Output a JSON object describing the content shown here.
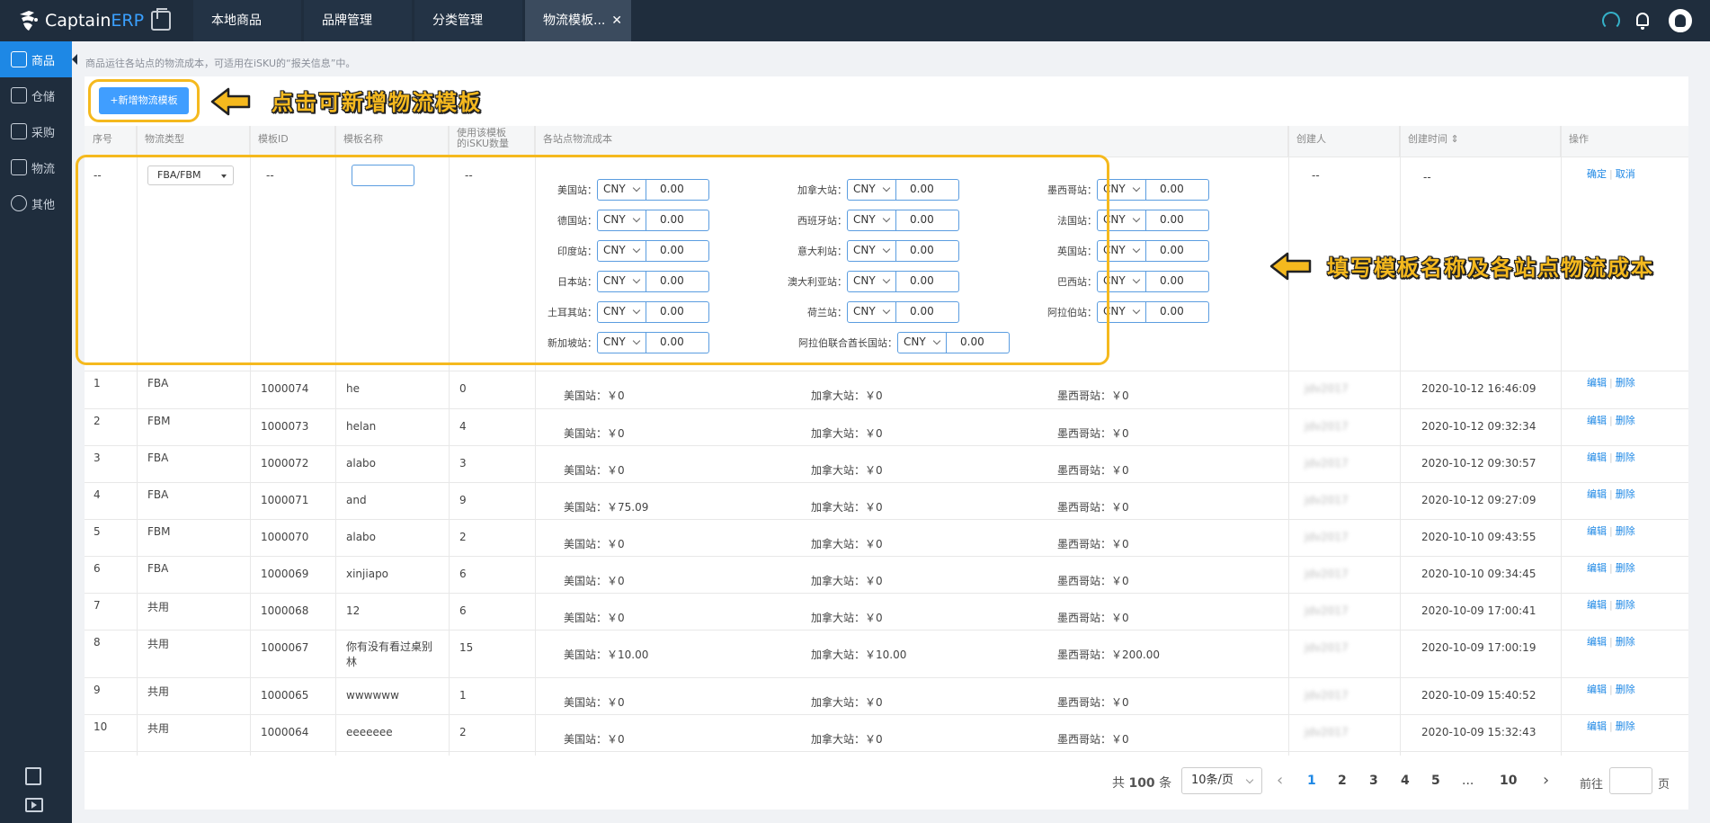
{
  "app": {
    "brand_main": "Captain",
    "brand_accent": "ERP"
  },
  "tabs": [
    {
      "label": "本地商品"
    },
    {
      "label": "品牌管理"
    },
    {
      "label": "分类管理"
    },
    {
      "label": "物流模板..."
    }
  ],
  "tab_close": "✕",
  "sidebar": [
    {
      "label": "商品"
    },
    {
      "label": "仓储"
    },
    {
      "label": "采购"
    },
    {
      "label": "物流"
    },
    {
      "label": "其他"
    }
  ],
  "hint": "商品运往各站点的物流成本，可适用在iSKU的“报关信息”中。",
  "add_button": "+新增物流模板",
  "callout_add": "点击可新增物流模板",
  "callout_fill": "填写模板名称及各站点物流成本",
  "columns": {
    "index": "序号",
    "type": "物流类型",
    "id": "模板ID",
    "name": "模板名称",
    "usage_1": "使用该模板",
    "usage_2": "的iSKU数量",
    "cost": "各站点物流成本",
    "creator": "创建人",
    "created": "创建时间 ⇕",
    "actions": "操作"
  },
  "edit_row": {
    "index": "--",
    "type_select": "FBA/FBM",
    "id": "--",
    "usage": "--",
    "creator": "--",
    "created": "--",
    "confirm": "确定",
    "cancel": "取消",
    "stations": [
      {
        "label": "美国站：",
        "currency": "CNY",
        "value": "0.00"
      },
      {
        "label": "加拿大站：",
        "currency": "CNY",
        "value": "0.00"
      },
      {
        "label": "墨西哥站：",
        "currency": "CNY",
        "value": "0.00"
      },
      {
        "label": "德国站：",
        "currency": "CNY",
        "value": "0.00"
      },
      {
        "label": "西班牙站：",
        "currency": "CNY",
        "value": "0.00"
      },
      {
        "label": "法国站：",
        "currency": "CNY",
        "value": "0.00"
      },
      {
        "label": "印度站：",
        "currency": "CNY",
        "value": "0.00"
      },
      {
        "label": "意大利站：",
        "currency": "CNY",
        "value": "0.00"
      },
      {
        "label": "英国站：",
        "currency": "CNY",
        "value": "0.00"
      },
      {
        "label": "日本站：",
        "currency": "CNY",
        "value": "0.00"
      },
      {
        "label": "澳大利亚站：",
        "currency": "CNY",
        "value": "0.00"
      },
      {
        "label": "巴西站：",
        "currency": "CNY",
        "value": "0.00"
      },
      {
        "label": "土耳其站：",
        "currency": "CNY",
        "value": "0.00"
      },
      {
        "label": "荷兰站：",
        "currency": "CNY",
        "value": "0.00"
      },
      {
        "label": "阿拉伯站：",
        "currency": "CNY",
        "value": "0.00"
      },
      {
        "label": "新加坡站：",
        "currency": "CNY",
        "value": "0.00"
      },
      {
        "label": "阿拉伯联合酋长国站：",
        "currency": "CNY",
        "value": "0.00"
      }
    ]
  },
  "rows": [
    {
      "index": "1",
      "type": "FBA",
      "id": "1000074",
      "name": "he",
      "usage": "0",
      "us": "美国站：￥0",
      "ca": "加拿大站：￥0",
      "mx": "墨西哥站：￥0",
      "creator": "jdv2017",
      "created": "2020-10-12 16:46:09"
    },
    {
      "index": "2",
      "type": "FBM",
      "id": "1000073",
      "name": "helan",
      "usage": "4",
      "us": "美国站：￥0",
      "ca": "加拿大站：￥0",
      "mx": "墨西哥站：￥0",
      "creator": "jdv2017",
      "created": "2020-10-12 09:32:34"
    },
    {
      "index": "3",
      "type": "FBA",
      "id": "1000072",
      "name": "alabo",
      "usage": "3",
      "us": "美国站：￥0",
      "ca": "加拿大站：￥0",
      "mx": "墨西哥站：￥0",
      "creator": "jdv2017",
      "created": "2020-10-12 09:30:57"
    },
    {
      "index": "4",
      "type": "FBA",
      "id": "1000071",
      "name": "and",
      "usage": "9",
      "us": "美国站：￥75.09",
      "ca": "加拿大站：￥0",
      "mx": "墨西哥站：￥0",
      "creator": "jdv2017",
      "created": "2020-10-12 09:27:09"
    },
    {
      "index": "5",
      "type": "FBM",
      "id": "1000070",
      "name": "alabo",
      "usage": "2",
      "us": "美国站：￥0",
      "ca": "加拿大站：￥0",
      "mx": "墨西哥站：￥0",
      "creator": "jdv2017",
      "created": "2020-10-10 09:43:55"
    },
    {
      "index": "6",
      "type": "FBA",
      "id": "1000069",
      "name": "xinjiapo",
      "usage": "6",
      "us": "美国站：￥0",
      "ca": "加拿大站：￥0",
      "mx": "墨西哥站：￥0",
      "creator": "jdv2017",
      "created": "2020-10-10 09:34:45"
    },
    {
      "index": "7",
      "type": "共用",
      "id": "1000068",
      "name": "12",
      "usage": "6",
      "us": "美国站：￥0",
      "ca": "加拿大站：￥0",
      "mx": "墨西哥站：￥0",
      "creator": "jdv2017",
      "created": "2020-10-09 17:00:41"
    },
    {
      "index": "8",
      "type": "共用",
      "id": "1000067",
      "name": "你有没有看过桌别",
      "name2": "林",
      "usage": "15",
      "us": "美国站：￥10.00",
      "ca": "加拿大站：￥10.00",
      "mx": "墨西哥站：￥200.00",
      "creator": "jdv2017",
      "created": "2020-10-09 17:00:19"
    },
    {
      "index": "9",
      "type": "共用",
      "id": "1000065",
      "name": "wwwwww",
      "usage": "1",
      "us": "美国站：￥0",
      "ca": "加拿大站：￥0",
      "mx": "墨西哥站：￥0",
      "creator": "jdv2017",
      "created": "2020-10-09 15:40:52"
    },
    {
      "index": "10",
      "type": "共用",
      "id": "1000064",
      "name": "eeeeeee",
      "usage": "2",
      "us": "美国站：￥0",
      "ca": "加拿大站：￥0",
      "mx": "墨西哥站：￥0",
      "creator": "jdv2017",
      "created": "2020-10-09 15:32:43"
    }
  ],
  "row_actions": {
    "edit": "编辑",
    "delete": "删除",
    "sep": "|"
  },
  "pagination": {
    "total_prefix": "共",
    "total": "100",
    "total_suffix": "条",
    "page_size": "10条/页",
    "pages": [
      "1",
      "2",
      "3",
      "4",
      "5",
      "...",
      "10"
    ],
    "prev": "‹",
    "next": "›",
    "goto": "前往",
    "goto_suffix": "页"
  },
  "colors": {
    "accent": "#1e88e5",
    "highlight": "#f5b91e",
    "topbar": "#1f2d3d"
  }
}
